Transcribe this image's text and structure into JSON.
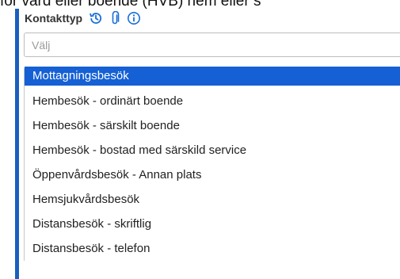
{
  "background_text": "för vård eller boende (HVB) hem eller s",
  "field": {
    "label": "Kontakttyp",
    "icons": [
      "history-icon",
      "paperclip-icon",
      "info-icon"
    ],
    "placeholder": "Välj"
  },
  "accent_color": "#1560d4",
  "options": [
    {
      "label": "Mottagningsbesök",
      "selected": true
    },
    {
      "label": "Hembesök - ordinärt boende",
      "selected": false
    },
    {
      "label": "Hembesök - särskilt boende",
      "selected": false
    },
    {
      "label": "Hembesök - bostad med särskild service",
      "selected": false
    },
    {
      "label": "Öppenvårdsbesök - Annan plats",
      "selected": false
    },
    {
      "label": "Hemsjukvårdsbesök",
      "selected": false
    },
    {
      "label": "Distansbesök - skriftlig",
      "selected": false
    },
    {
      "label": "Distansbesök - telefon",
      "selected": false
    }
  ]
}
